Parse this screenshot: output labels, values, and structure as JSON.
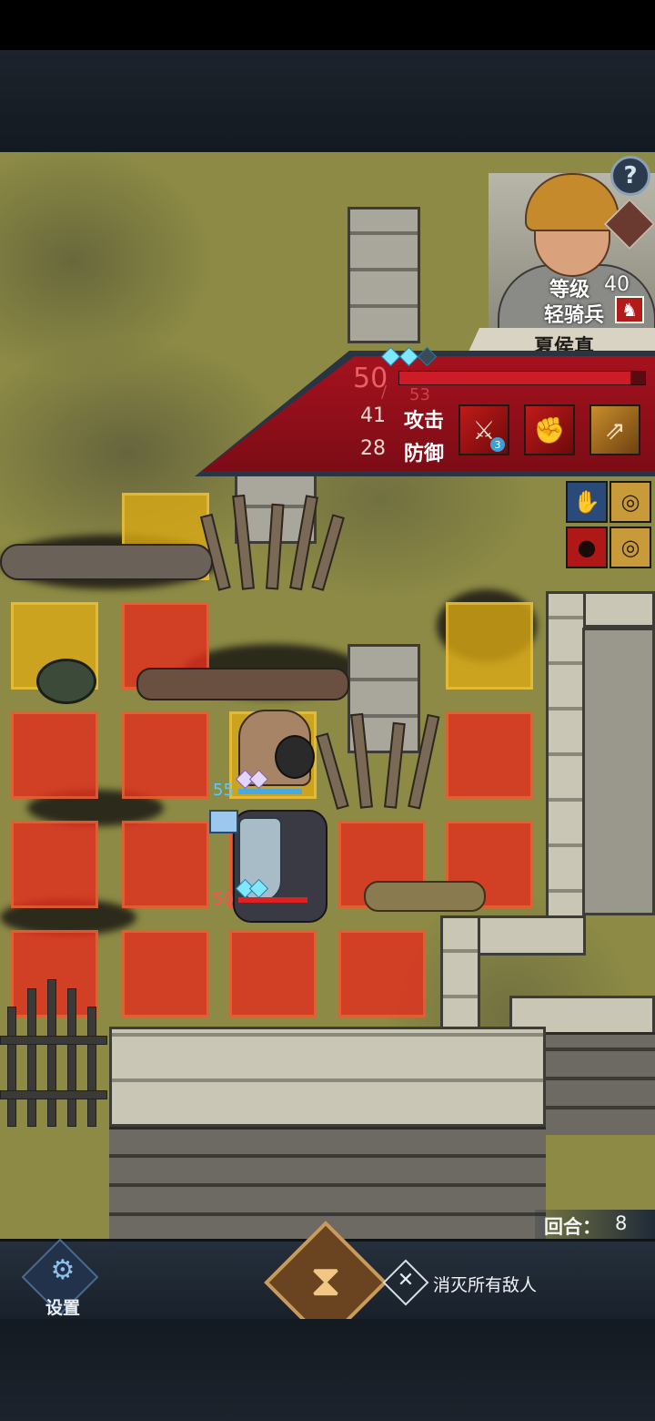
{
  "unit": {
    "name": "夏侯真",
    "level_label": "等级",
    "level": "40",
    "class_label": "轻骑兵",
    "class_icon": "horse-icon",
    "hp_current": "50",
    "hp_max": "53",
    "hp_fraction": 0.94,
    "hp_divider": "/",
    "attack_value": "41",
    "attack_label": "攻击",
    "defense_value": "28",
    "defense_label": "防御",
    "skills": [
      {
        "icon": "sword-arrow-icon",
        "badge": "3",
        "style": "red"
      },
      {
        "icon": "horse-charge-icon",
        "badge": "",
        "style": "red"
      },
      {
        "icon": "sword-up-icon",
        "badge": "",
        "style": "gold"
      }
    ],
    "rank_gems": 3,
    "rank_gems_filled": 2
  },
  "buttons": {
    "help": "?",
    "settings_label": "设置",
    "end_turn_icon": "hourglass-icon"
  },
  "objective": {
    "icon": "crossed-swords-icon",
    "text": "消灭所有敌人"
  },
  "turn": {
    "label": "回合：",
    "value": "8"
  },
  "field_units": [
    {
      "name": "player-knight",
      "hp": "55",
      "hp_color": "#5ec8ff"
    },
    {
      "name": "player-cavalry",
      "hp": "50",
      "hp_color": "#ff5050"
    }
  ],
  "status_icons": [
    "arm-buff-icon",
    "target-icon",
    "blood-drop-icon",
    "target-icon"
  ],
  "colors": {
    "move_range": "#e0301e",
    "attack_range": "#dcaa14",
    "panel_red": "#a5121e"
  }
}
